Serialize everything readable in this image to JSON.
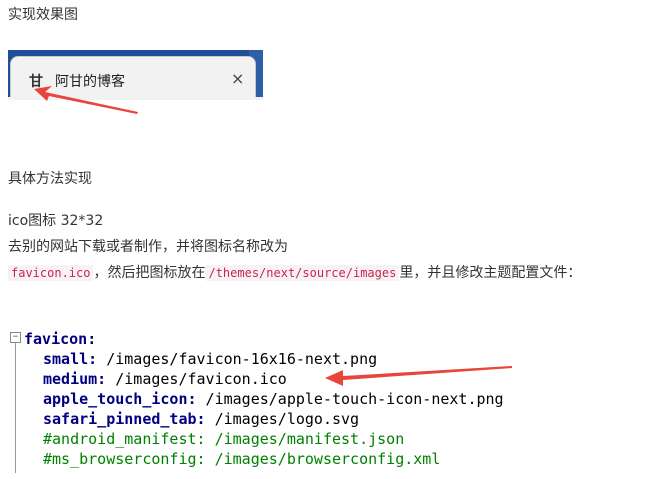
{
  "heading_result": "实现效果图",
  "browser_tab": {
    "favicon_glyph": "甘",
    "title": "阿甘的博客",
    "close_glyph": "×"
  },
  "heading_method": "具体方法实现",
  "line1": "ico图标 32*32",
  "line2": "去别的网站下载或者制作，并将图标名称改为",
  "line3": {
    "code1": "favicon.ico",
    "text1": "，然后把图标放在",
    "code2": "/themes/next/source/images",
    "text2": "里，并且修改主题配置文件："
  },
  "code_block": {
    "root_key": "favicon:",
    "lines": [
      {
        "key": "small:",
        "value": " /images/favicon-16x16-next.png"
      },
      {
        "key": "medium:",
        "value": " /images/favicon.ico"
      },
      {
        "key": "apple_touch_icon:",
        "value": " /images/apple-touch-icon-next.png"
      },
      {
        "key": "safari_pinned_tab:",
        "value": " /images/logo.svg"
      }
    ],
    "comments": [
      "#android_manifest: /images/manifest.json",
      "#ms_browserconfig: /images/browserconfig.xml"
    ]
  },
  "colors": {
    "arrow": "#e8453c",
    "key": "#000080",
    "comment": "#008000",
    "inline_code": "#c7254e"
  }
}
